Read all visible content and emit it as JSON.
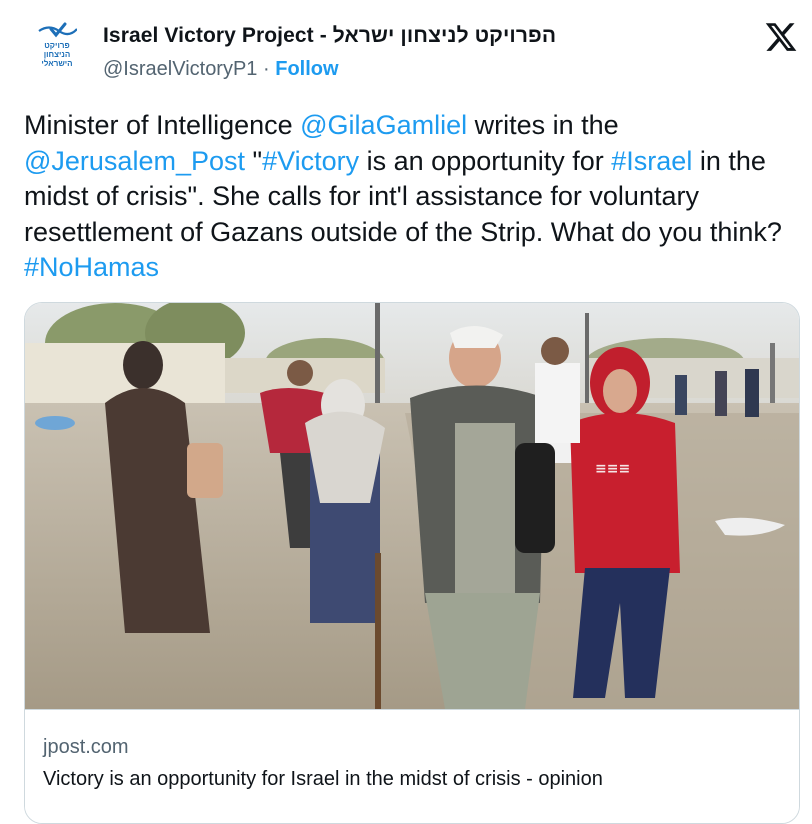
{
  "tweet": {
    "author": {
      "display_name": "Israel Victory Project - הפרויקט לניצחון ישראל",
      "handle": "@IsraelVictoryP1",
      "separator": "·",
      "follow_label": "Follow",
      "avatar_text": [
        "פרויקט",
        "הניצחון",
        "הישראלי"
      ]
    },
    "text_segments": [
      {
        "text": "Minister of Intelligence ",
        "link": false
      },
      {
        "text": "@GilaGamliel",
        "link": true
      },
      {
        "text": " writes in the ",
        "link": false
      },
      {
        "text": "@Jerusalem_Post",
        "link": true
      },
      {
        "text": " \"",
        "link": false
      },
      {
        "text": "#Victory",
        "link": true
      },
      {
        "text": " is an opportunity for ",
        "link": false
      },
      {
        "text": "#Israel",
        "link": true
      },
      {
        "text": " in the midst of crisis\". She calls for int'l assistance for voluntary resettlement of Gazans outside of the Strip. What do you think? ",
        "link": false
      },
      {
        "text": "#NoHamas",
        "link": true
      }
    ],
    "link_card": {
      "domain": "jpost.com",
      "title": "Victory is an opportunity for Israel in the midst of crisis - opinion"
    }
  },
  "colors": {
    "link": "#1d9bf0",
    "secondary_text": "#536471",
    "primary_text": "#0f1419",
    "border": "#cfd9de"
  },
  "icons": {
    "platform_logo": "x-logo-icon",
    "avatar": "israel-victory-project-logo"
  }
}
